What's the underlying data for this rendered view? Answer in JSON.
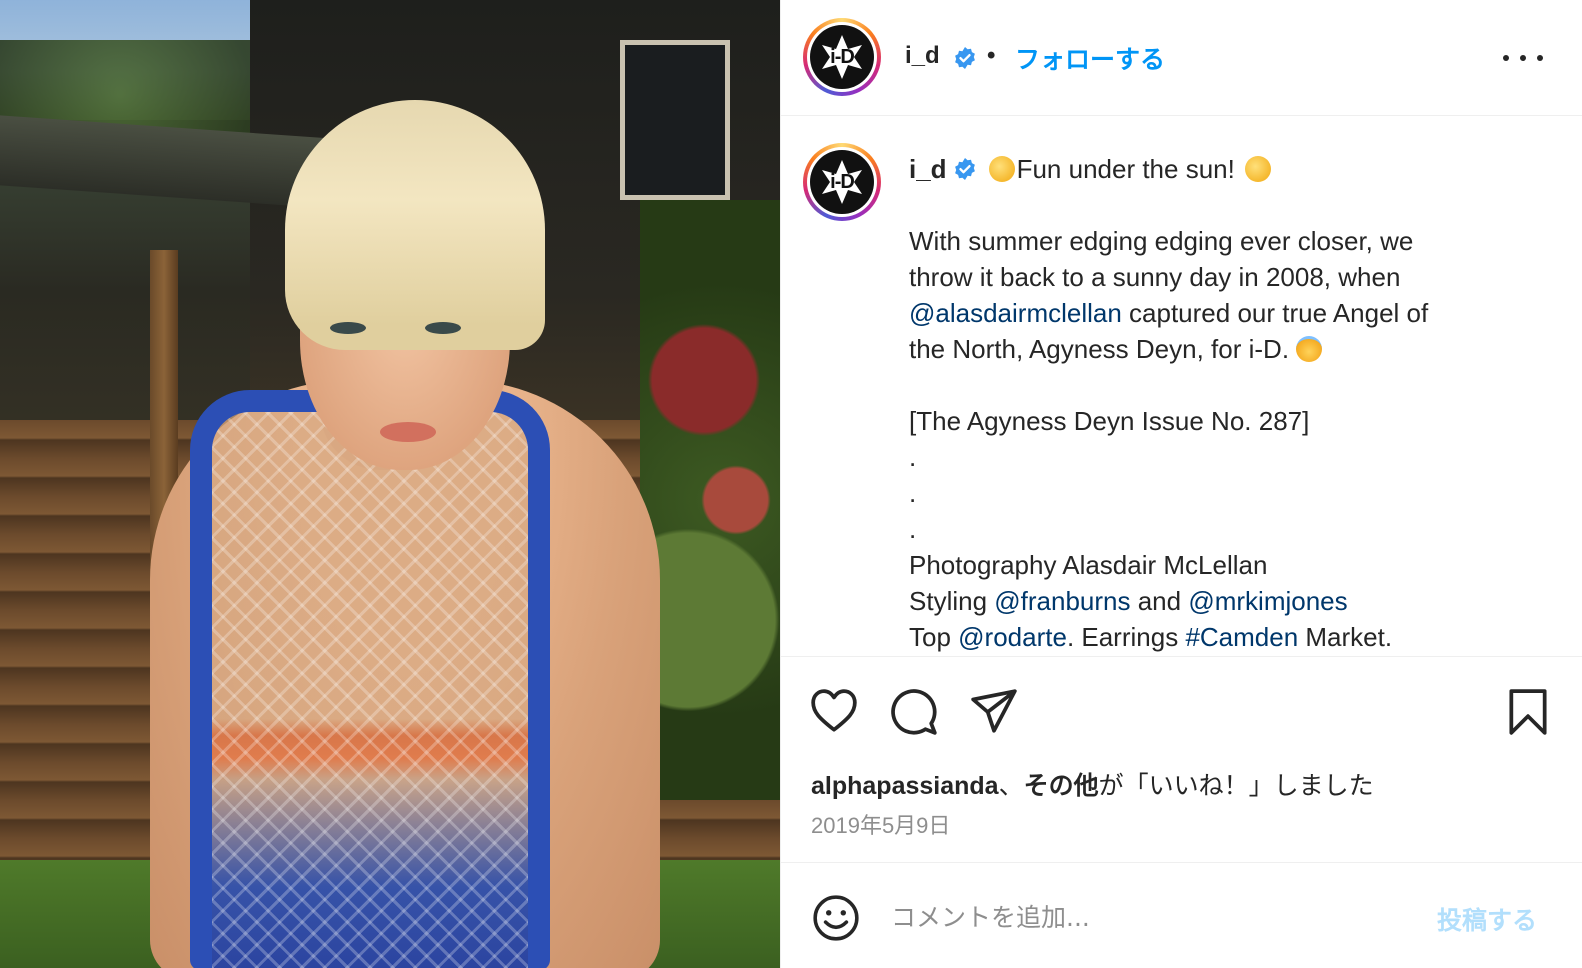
{
  "post": {
    "username": "i_d",
    "follow_label": "フォローする",
    "separator": "•",
    "avatar_text": "i-D"
  },
  "caption": {
    "username": "i_d",
    "headline": "Fun under the sun!",
    "body_line1": "With summer edging edging ever closer, we",
    "body_line2": "throw it back to a sunny day in 2008, when",
    "mention_photographer": "@alasdairmclellan",
    "body_line3_rest": " captured our true Angel of",
    "body_line4": "the North, Agyness Deyn, for i-D. ",
    "issue": "[The Agyness Deyn Issue No. 287]",
    "dot1": ".",
    "dot2": ".",
    "dot3": ".",
    "photo_credit": "Photography Alasdair McLellan",
    "styling_label": "Styling ",
    "mention_stylist1": "@franburns",
    "and_label": " and ",
    "mention_stylist2": "@mrkimjones",
    "top_label": "Top ",
    "mention_top": "@rodarte",
    "earrings_label": ". Earrings ",
    "hashtag_camden": "#Camden",
    "market_label": " Market."
  },
  "likes": {
    "user": "alphapassianda",
    "comma": "、",
    "others": "その他",
    "rest": "が「いいね！」しました"
  },
  "date": "2019年5月9日",
  "comment": {
    "placeholder": "コメントを追加...",
    "post_label": "投稿する"
  },
  "colors": {
    "accent_blue": "#0095f6",
    "mention_blue": "#00376b",
    "post_button_disabled": "#b2dffc",
    "verified_blue": "#3897f0",
    "text": "#262626",
    "muted": "#8e8e8e"
  },
  "icons": [
    "verified-badge-icon",
    "more-options-icon",
    "heart-icon",
    "comment-icon",
    "share-icon",
    "bookmark-icon",
    "emoji-icon",
    "sun-emoji-icon",
    "halo-emoji-icon"
  ]
}
